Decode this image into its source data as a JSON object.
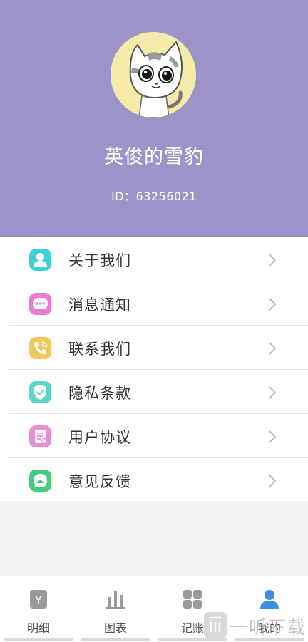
{
  "profile": {
    "username": "英俊的雪豹",
    "id_text": "ID：63256021"
  },
  "menu": {
    "items": [
      {
        "label": "关于我们",
        "icon": "user-icon",
        "color": "#3fd0d9"
      },
      {
        "label": "消息通知",
        "icon": "chat-icon",
        "color": "#e97bd6"
      },
      {
        "label": "联系我们",
        "icon": "phone-icon",
        "color": "#f2c65c"
      },
      {
        "label": "隐私条款",
        "icon": "shield-icon",
        "color": "#5ed6c6"
      },
      {
        "label": "用户协议",
        "icon": "document-icon",
        "color": "#e58ed3"
      },
      {
        "label": "意见反馈",
        "icon": "feedback-icon",
        "color": "#3fcf7a"
      }
    ]
  },
  "tabbar": {
    "tabs": [
      {
        "label": "明细",
        "icon": "ledger-icon"
      },
      {
        "label": "图表",
        "icon": "bar-chart-icon"
      },
      {
        "label": "记账",
        "icon": "grid-icon"
      },
      {
        "label": "我的",
        "icon": "person-icon",
        "active": true
      }
    ]
  },
  "watermark": {
    "text": "一听下载"
  },
  "colors": {
    "header_bg": "#9b94c9",
    "active_tab": "#3b8fe0",
    "inactive_tab": "#9a9a9a"
  }
}
